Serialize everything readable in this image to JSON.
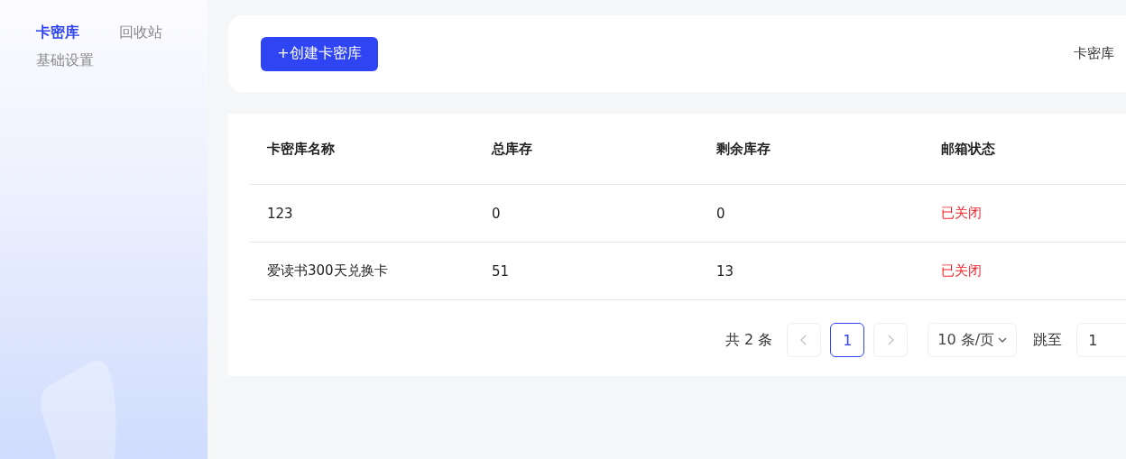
{
  "sidebar": {
    "tabs": [
      {
        "label": "卡密库",
        "selected": true
      },
      {
        "label": "回收站",
        "selected": false
      }
    ],
    "items": [
      {
        "label": "基础设置",
        "selected": false
      }
    ]
  },
  "toolbar": {
    "create_button": "+创建卡密库",
    "filter_label": "卡密库"
  },
  "table": {
    "columns": [
      "卡密库名称",
      "总库存",
      "剩余库存",
      "邮箱状态"
    ],
    "rows": [
      {
        "name": "123",
        "total": "0",
        "remaining": "0",
        "email_status": "已关闭",
        "email_enabled": false
      },
      {
        "name": "爱读书300天兑换卡",
        "total": "51",
        "remaining": "13",
        "email_status": "已关闭",
        "email_enabled": false
      }
    ]
  },
  "pagination": {
    "total": "共 2 条",
    "prev_disabled": true,
    "next_disabled": true,
    "pages": [
      {
        "label": "1",
        "selected": true
      }
    ],
    "page_size": "10 条/页",
    "jump_label": "跳至",
    "jump_value": "1"
  }
}
